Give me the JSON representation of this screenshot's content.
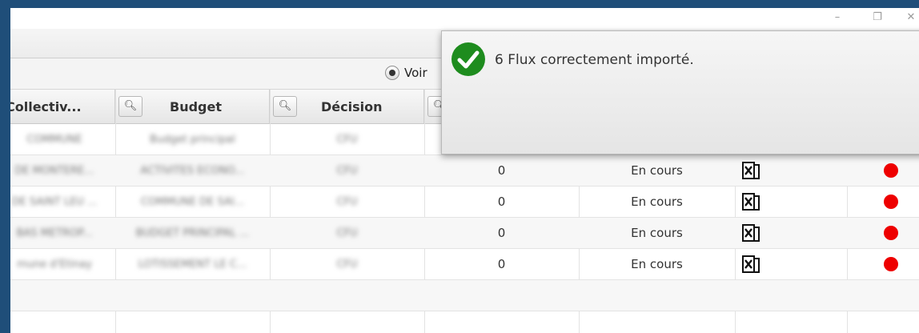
{
  "window": {
    "controls": [
      "–",
      "❐",
      "✕"
    ]
  },
  "toolbar": {
    "radio_label": "Voir"
  },
  "table": {
    "columns": [
      {
        "label": "Collectiv..."
      },
      {
        "label": "Budget"
      },
      {
        "label": "Décision"
      }
    ],
    "rows": [
      {
        "collectivite": "COMMUNE",
        "budget": "Budget principal",
        "decision": "CFU",
        "value": "",
        "status": "",
        "has_file": false,
        "has_dot": false
      },
      {
        "collectivite": "DE MONTERE...",
        "budget": "ACTIVITES ECONO...",
        "decision": "CFU",
        "value": "0",
        "status": "En cours",
        "has_file": true,
        "has_dot": true
      },
      {
        "collectivite": "DE SAINT LEU ...",
        "budget": "COMMUNE DE SAI...",
        "decision": "CFU",
        "value": "0",
        "status": "En cours",
        "has_file": true,
        "has_dot": true
      },
      {
        "collectivite": "BAS METROP...",
        "budget": "BUDGET PRINCIPAL ...",
        "decision": "CFU",
        "value": "0",
        "status": "En cours",
        "has_file": true,
        "has_dot": true
      },
      {
        "collectivite": "mune d'Etinay",
        "budget": "LOTISSEMENT LE C...",
        "decision": "CFU",
        "value": "0",
        "status": "En cours",
        "has_file": true,
        "has_dot": true
      },
      {
        "collectivite": "",
        "budget": "",
        "decision": "",
        "value": "",
        "status": "",
        "has_file": false,
        "has_dot": false
      },
      {
        "collectivite": "",
        "budget": "",
        "decision": "",
        "value": "",
        "status": "",
        "has_file": false,
        "has_dot": false
      }
    ]
  },
  "notification": {
    "message": "6 Flux correctement importé.",
    "close": "×"
  },
  "colors": {
    "background": "#1f4e79",
    "status_dot": "#ee0000",
    "success": "#1e8c1e"
  },
  "icons": {
    "search": "search-icon",
    "file": "excel-file-icon",
    "success": "check-circle-icon"
  }
}
